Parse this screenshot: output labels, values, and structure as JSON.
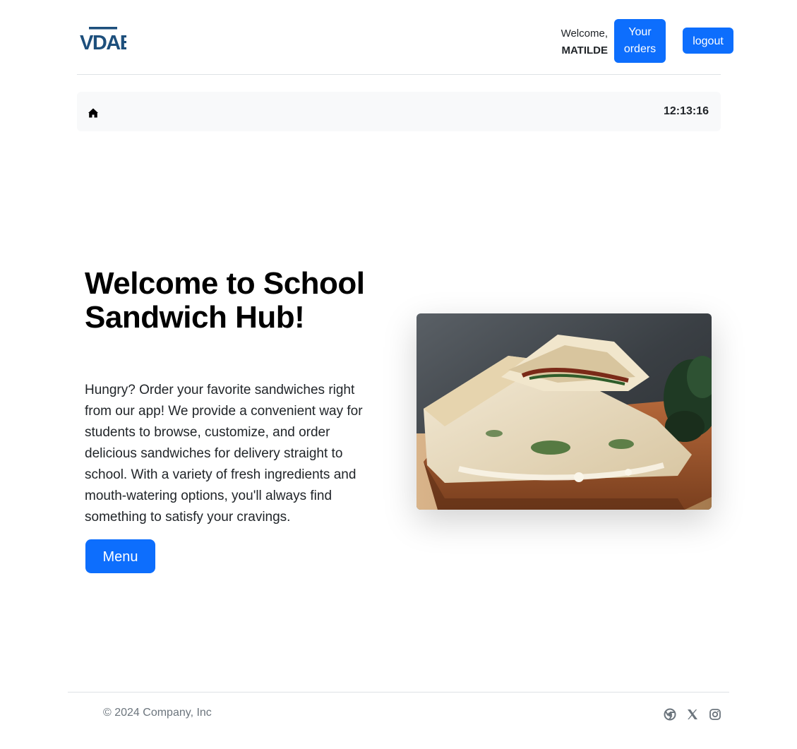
{
  "header": {
    "logo_text": "VDAB",
    "welcome_greeting": "Welcome,",
    "user_name": "MATILDE",
    "orders_button_label": "Your orders",
    "logout_button_label": "logout"
  },
  "breadcrumb": {
    "home_icon": "home-icon",
    "clock": "12:13:16"
  },
  "hero": {
    "title": "Welcome to School Sandwich Hub!",
    "description": "Hungry? Order your favorite sandwiches right from our app! We provide a convenient way for students to browse, customize, and order delicious sandwiches for delivery straight to school. With a variety of fresh ingredients and mouth-watering options, you'll always find something to satisfy your cravings.",
    "menu_button_label": "Menu",
    "image_subject": "grilled panini sandwich on wooden board"
  },
  "footer": {
    "copyright": "© 2024 Company, Inc",
    "social_icons": [
      "chrome-icon",
      "x-icon",
      "instagram-icon"
    ]
  },
  "colors": {
    "primary": "#0d6efd",
    "logo": "#1d4f7c",
    "bar_bg": "#f8f9fa",
    "muted": "#6c757d"
  }
}
